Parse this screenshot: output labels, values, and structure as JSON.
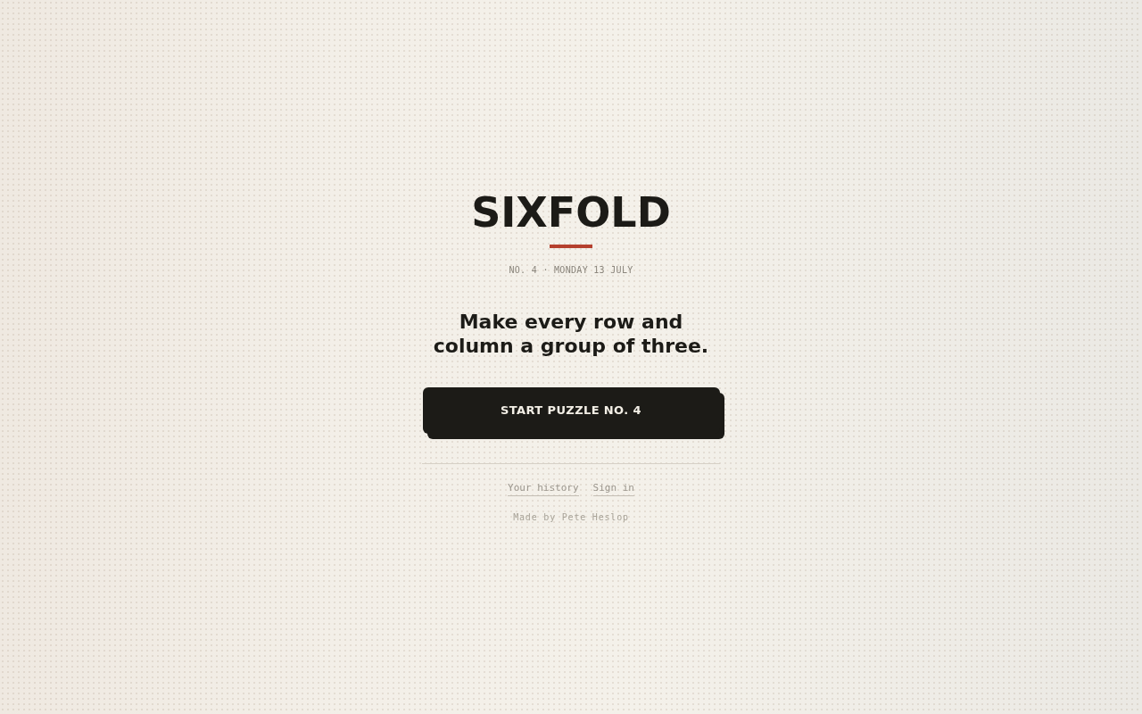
{
  "title": "SIXFOLD",
  "issue_line": "NO. 4 · MONDAY 13 JULY",
  "instruction": "Make every row and column a group of three.",
  "start_button": {
    "label": "START PUZZLE NO. 4"
  },
  "links": [
    {
      "label": "Your history"
    },
    {
      "label": "Sign in"
    }
  ],
  "credit": "Made by Pete Heslop"
}
